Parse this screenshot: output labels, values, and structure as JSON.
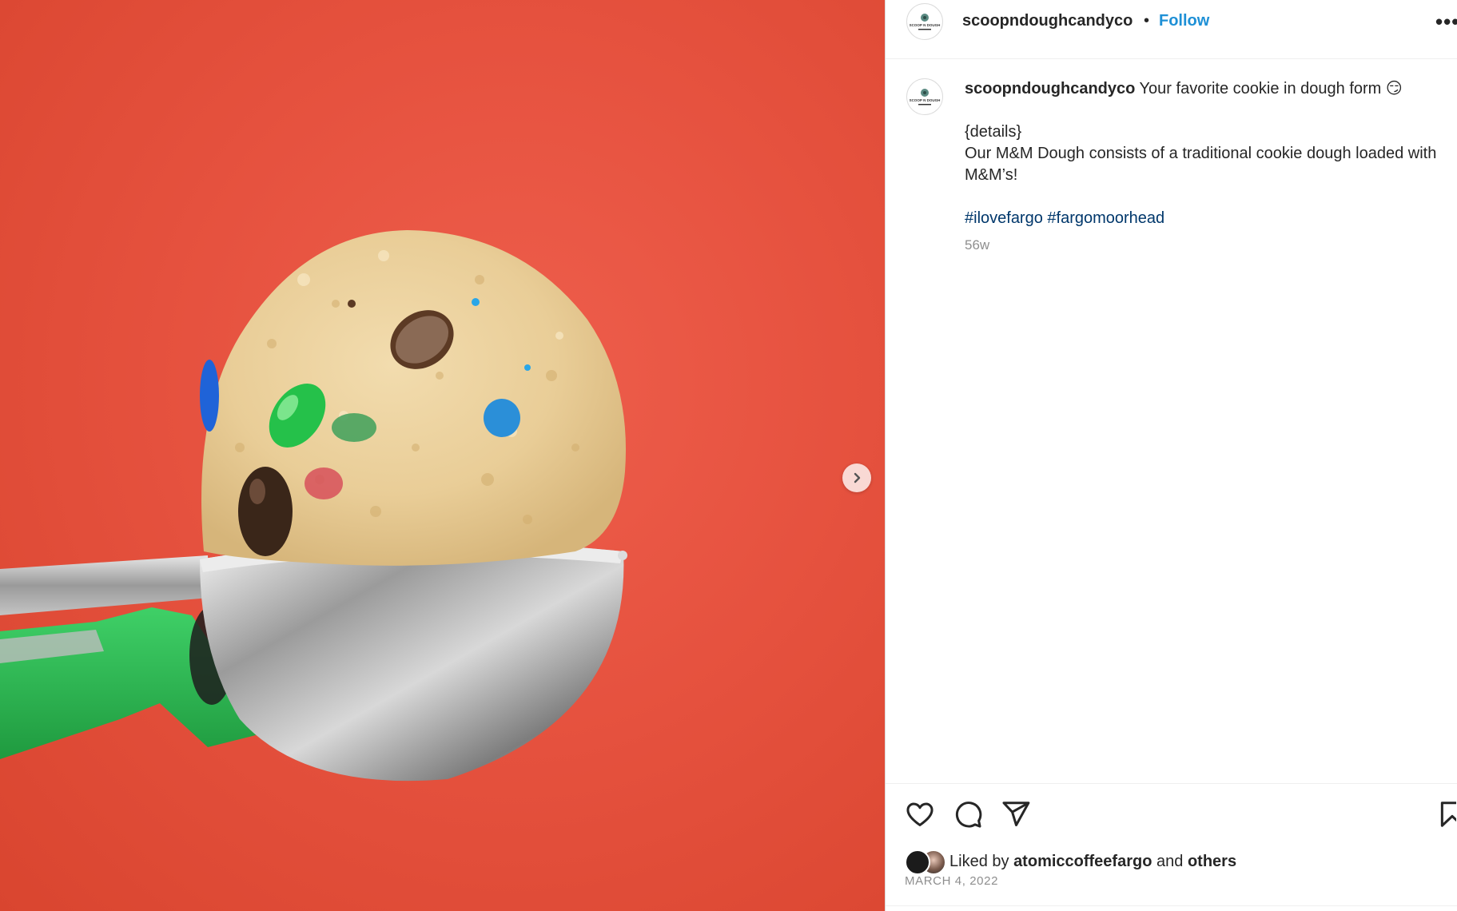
{
  "account": {
    "username": "scoopndoughcandyco",
    "avatar_logo": "SCOOP N DOUGH"
  },
  "header": {
    "dot": "•",
    "follow_label": "Follow",
    "more_icon": "more-horizontal-icon"
  },
  "caption": {
    "username": "scoopndoughcandyco",
    "text": "Your favorite cookie in dough form 😏",
    "details_heading": "{details}",
    "body": "Our M&M Dough consists of a traditional cookie dough loaded with M&M’s!",
    "hashtags": [
      "#ilovefargo",
      "#fargomoorhead"
    ],
    "age": "56w"
  },
  "actions": {
    "like": "heart-icon",
    "comment": "comment-icon",
    "share": "send-icon",
    "save": "bookmark-icon"
  },
  "likes": {
    "prefix": "Liked by",
    "user": "atomiccoffeefargo",
    "and": "and",
    "others": "others"
  },
  "date": "MARCH 4, 2022",
  "colors": {
    "follow": "#1e90d6",
    "hashtag": "#00376b",
    "photo_background": "#e6523f"
  }
}
